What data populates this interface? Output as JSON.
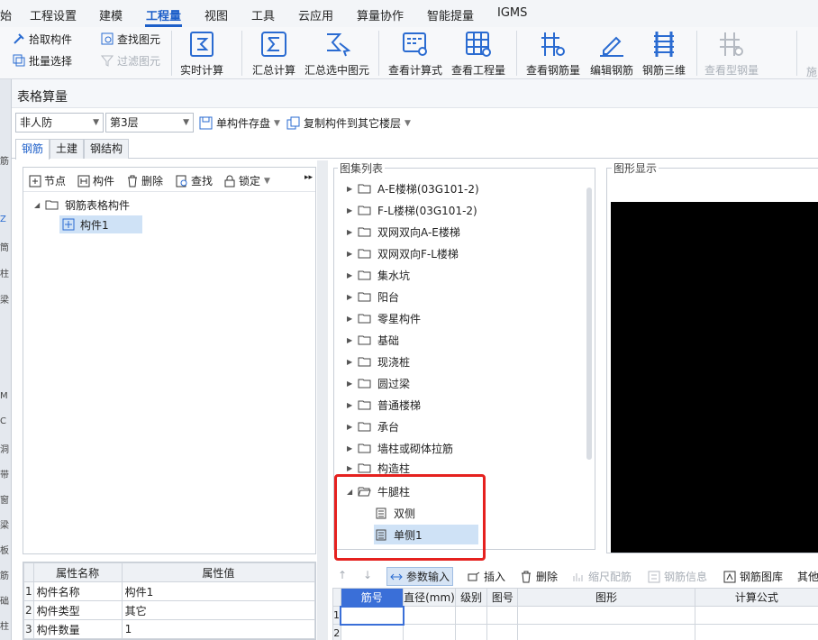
{
  "menu": {
    "items": [
      "始",
      "工程设置",
      "建模",
      "工程量",
      "视图",
      "工具",
      "云应用",
      "算量协作",
      "智能提量",
      "IGMS"
    ],
    "active_index": 3
  },
  "ribbon": {
    "pick_component": "拾取构件",
    "batch_select": "批量选择",
    "find_element": "查找图元",
    "filter_element": "过滤图元",
    "realtime_calc": "实时计算",
    "summary_calc": "汇总计算",
    "summary_selected": "汇总选中图元",
    "view_formula": "查看计算式",
    "view_quantity": "查看工程量",
    "view_rebar_qty": "查看钢筋量",
    "edit_rebar": "编辑钢筋",
    "rebar_3d": "钢筋三维",
    "view_steel_qty": "查看型钢量",
    "cut_text": "施"
  },
  "left_strip": [
    "筋",
    "Z",
    "筒",
    "柱",
    "梁",
    "M",
    "C",
    "洞",
    "带",
    "窗",
    "梁",
    "板",
    "筋",
    "础",
    "柱"
  ],
  "dialog": {
    "title": "表格算量",
    "defense_select": "非人防",
    "floor_select": "第3层",
    "save_component": "单构件存盘",
    "copy_to_floors": "复制构件到其它楼层",
    "tabs": [
      "钢筋",
      "土建",
      "钢结构"
    ],
    "active_tab": 0
  },
  "left_panel": {
    "toolbar": {
      "node": "节点",
      "component": "构件",
      "delete": "删除",
      "find": "查找",
      "lock": "锁定"
    },
    "tree_root": "钢筋表格构件",
    "tree_child": "构件1"
  },
  "properties": {
    "headers": [
      "属性名称",
      "属性值"
    ],
    "rows": [
      {
        "idx": "1",
        "name": "构件名称",
        "value": "构件1"
      },
      {
        "idx": "2",
        "name": "构件类型",
        "value": "其它"
      },
      {
        "idx": "3",
        "name": "构件数量",
        "value": "1"
      }
    ]
  },
  "atlas": {
    "title": "图集列表",
    "items": [
      "A-E楼梯(03G101-2)",
      "F-L楼梯(03G101-2)",
      "双网双向A-E楼梯",
      "双网双向F-L楼梯",
      "集水坑",
      "阳台",
      "零星构件",
      "基础",
      "现浇桩",
      "圆过梁",
      "普通楼梯",
      "承台",
      "墙柱或砌体拉筋",
      "构造柱"
    ],
    "expanded": "牛腿柱",
    "children": [
      "双侧",
      "单侧1"
    ],
    "selected_child": 1
  },
  "preview": {
    "title": "图形显示"
  },
  "calc_toolbar": {
    "param_input": "参数输入",
    "insert": "插入",
    "delete": "删除",
    "scale_rebar": "缩尺配筋",
    "rebar_info": "钢筋信息",
    "rebar_library": "钢筋图库",
    "other": "其他"
  },
  "calc_grid": {
    "headers": [
      "筋号",
      "直径(mm)",
      "级别",
      "图号",
      "图形",
      "计算公式"
    ],
    "rows": [
      "1",
      "2"
    ]
  },
  "colors": {
    "accent": "#1d5fc9",
    "highlight": "#e5211f",
    "selection": "#cfe2f6"
  }
}
